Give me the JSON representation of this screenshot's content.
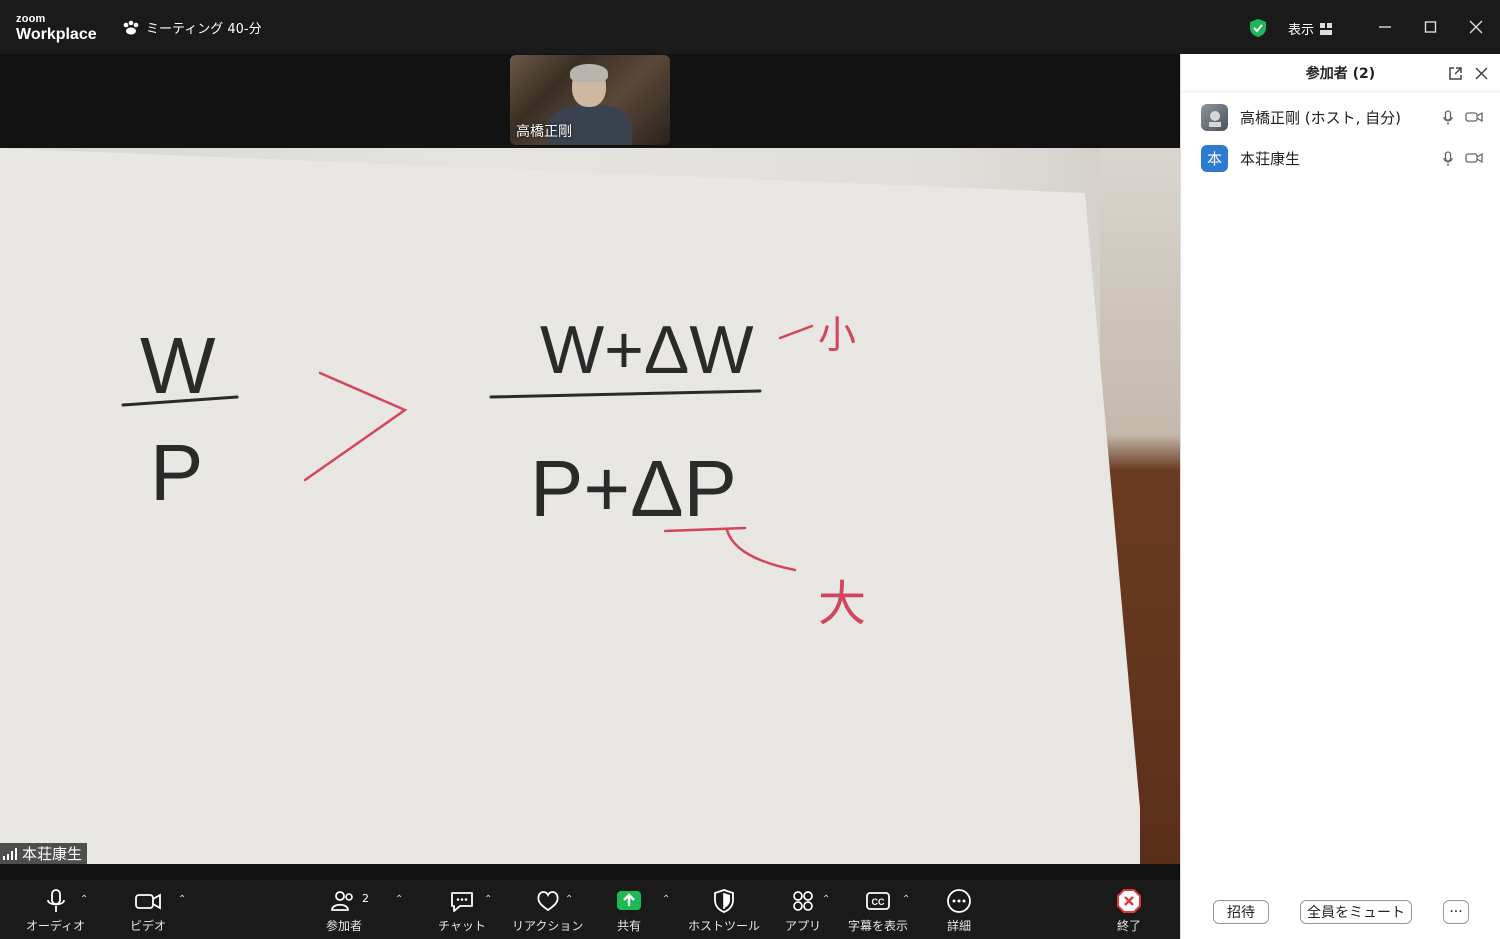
{
  "app": {
    "logo_small": "zoom",
    "logo_big": "Workplace",
    "meeting_title": "ミーティング 40-分",
    "view_label": "表示"
  },
  "thumbnail": {
    "name": "高橋正剛"
  },
  "main_video": {
    "name": "本荘康生",
    "board": {
      "numerator_left": "W",
      "denominator_left": "P",
      "numerator_right": "W+ΔW",
      "denominator_right": "P+ΔP",
      "note_small": "小",
      "note_large": "大"
    }
  },
  "toolbar": {
    "audio": "オーディオ",
    "video": "ビデオ",
    "participants": "参加者",
    "participants_count": "2",
    "chat": "チャット",
    "reactions": "リアクション",
    "share": "共有",
    "host_tools": "ホストツール",
    "apps": "アプリ",
    "captions": "字幕を表示",
    "more": "詳細",
    "end": "終了"
  },
  "panel": {
    "title": "参加者 (2)",
    "participants": [
      {
        "name": "高橋正剛 (ホスト, 自分)",
        "avatar": "img"
      },
      {
        "name": "本荘康生",
        "avatar": "本"
      }
    ],
    "invite": "招待",
    "mute_all": "全員をミュート",
    "more": "···"
  },
  "colors": {
    "share_green": "#1db954",
    "shield_green": "#1fb55a",
    "end_red": "#e5383b",
    "avatar_blue": "#2d7bd1"
  }
}
